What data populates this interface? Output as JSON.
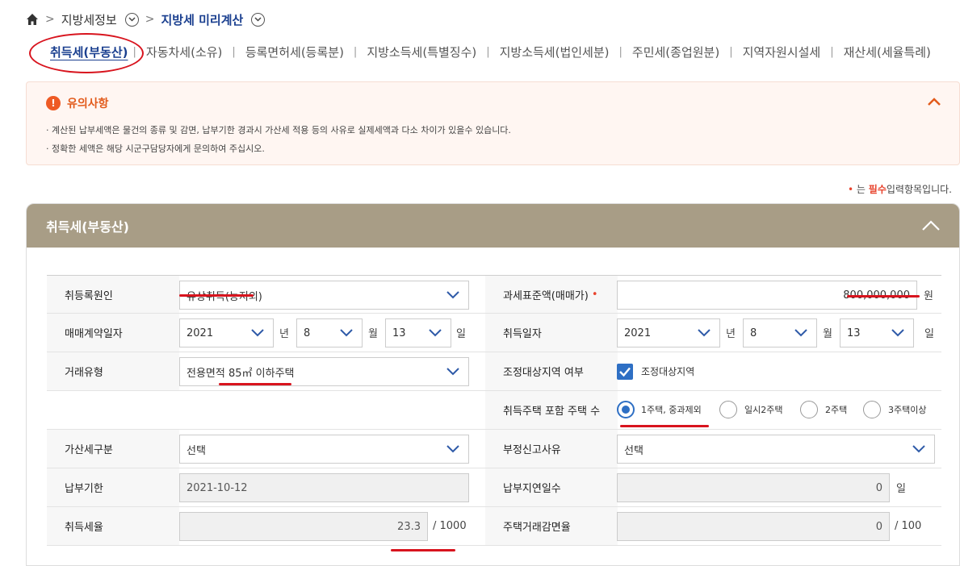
{
  "breadcrumb": {
    "items": [
      "지방세정보",
      "지방세 미리계산"
    ]
  },
  "tabs": [
    "취득세(부동산)",
    "자동차세(소유)",
    "등록면허세(등록분)",
    "지방소득세(특별징수)",
    "지방소득세(법인세분)",
    "주민세(종업원분)",
    "지역자원시설세",
    "재산세(세율특례)"
  ],
  "notice": {
    "title": "유의사항",
    "lines": [
      "· 계산된 납부세액은 물건의 종류 및 감면, 납부기한 경과시 가산세 적용 등의 사유로 실제세액과 다소 차이가 있을수 있습니다.",
      "· 정확한 세액은 해당 시군구담당자에게 문의하여 주십시오."
    ]
  },
  "required_note": {
    "dot": "•",
    "pre": "는",
    "word": "필수",
    "post": "입력항목입니다."
  },
  "panel": {
    "title": "취득세(부동산)",
    "rows": {
      "r1": {
        "label_left": "취등록원인",
        "value_left": "유상취득(농지외)",
        "label_right": "과세표준액(매매가)",
        "required_mark": "•",
        "value_right": "800,000,000",
        "unit_right": "원"
      },
      "r2": {
        "label_left": "매매계약일자",
        "year_left": "2021",
        "month_left": "8",
        "day_left": "13",
        "label_right": "취득일자",
        "year_right": "2021",
        "month_right": "8",
        "day_right": "13",
        "unit_year": "년",
        "unit_month": "월",
        "unit_day": "일"
      },
      "r3": {
        "label_left": "거래유형",
        "value_left": "전용면적 85㎡ 이하주택",
        "label_right": "조정대상지역 여부",
        "checkbox_label": "조정대상지역"
      },
      "r4": {
        "label_right": "취득주택 포함 주택 수",
        "options": [
          "1주택, 중과제외",
          "일시2주택",
          "2주택",
          "3주택이상"
        ],
        "selected_index": 0
      },
      "r5": {
        "label_left": "가산세구분",
        "value_left": "선택",
        "label_right": "부정신고사유",
        "value_right": "선택"
      },
      "r6": {
        "label_left": "납부기한",
        "value_left": "2021-10-12",
        "label_right": "납부지연일수",
        "value_right": "0",
        "unit_right": "일"
      },
      "r7": {
        "label_left": "취득세율",
        "value_left": "23.3",
        "unit_left": "/ 1000",
        "label_right": "주택거래감면율",
        "value_right": "0",
        "unit_right": "/ 100"
      }
    }
  },
  "colors": {
    "accent": "#1a3f8f",
    "panel_header": "#a89d86",
    "warning": "#ee5a24",
    "annotation": "#d8141e",
    "checkbox": "#2e6fc4"
  }
}
